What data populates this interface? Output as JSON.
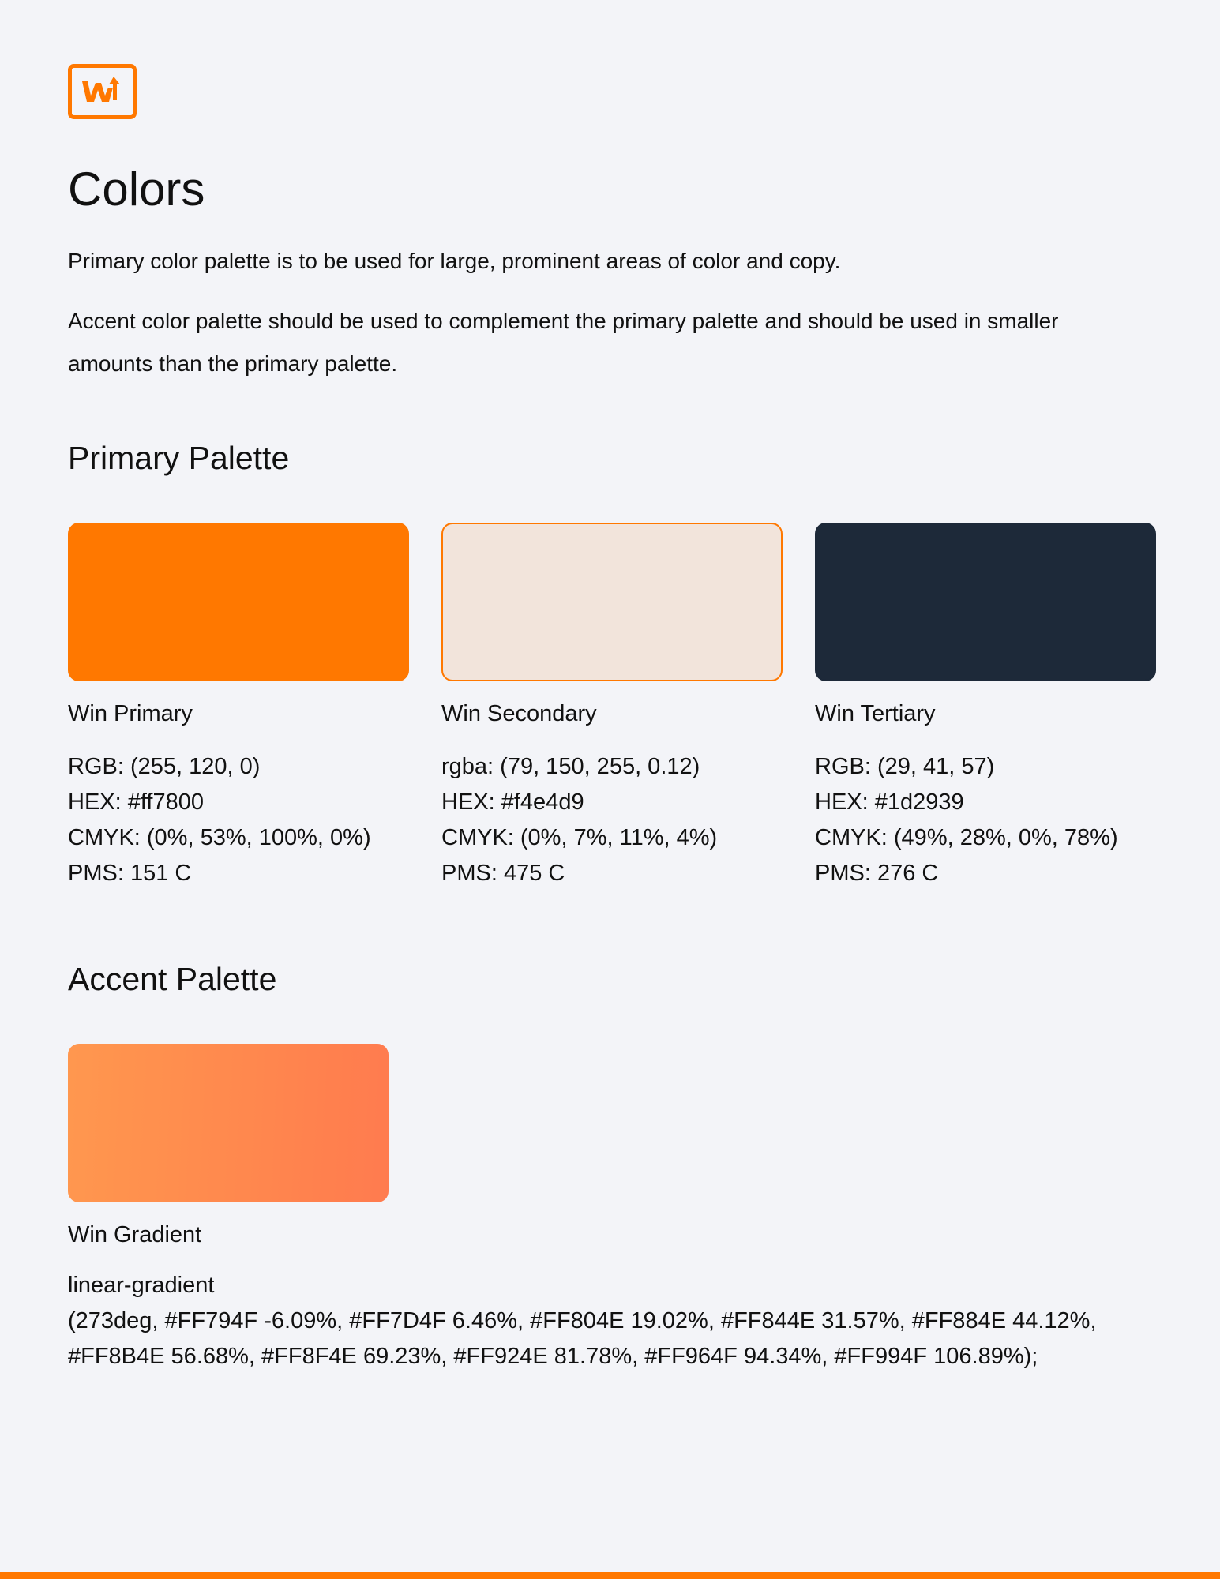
{
  "brand": {
    "logo_icon": "win-logo-icon",
    "accent_color": "#ff7800"
  },
  "page": {
    "title": "Colors",
    "background": "#f3f4f8",
    "intro": [
      "Primary color palette is to be used for large, prominent areas of color and copy.",
      "Accent color palette should be used to complement the primary palette and should be used in smaller amounts than the primary palette."
    ]
  },
  "primary_palette": {
    "heading": "Primary Palette",
    "swatches": [
      {
        "name": "Win Primary",
        "color": "#ff7800",
        "border": "#ff7800",
        "rgb": "RGB: (255, 120, 0)",
        "hex": "HEX: #ff7800",
        "cmyk": "CMYK: (0%, 53%, 100%, 0%)",
        "pms": "PMS: 151 C"
      },
      {
        "name": "Win Secondary",
        "color": "#f2e4db",
        "border": "#ff7800",
        "rgb": "rgba: (79, 150, 255, 0.12)",
        "hex": "HEX: #f4e4d9",
        "cmyk": "CMYK: (0%, 7%, 11%, 4%)",
        "pms": "PMS: 475 C"
      },
      {
        "name": "Win Tertiary",
        "color": "#1d2939",
        "border": "#1d2939",
        "rgb": "RGB: (29, 41, 57)",
        "hex": "HEX: #1d2939",
        "cmyk": "CMYK: (49%, 28%, 0%, 78%)",
        "pms": "PMS: 276 C"
      }
    ]
  },
  "accent_palette": {
    "heading": "Accent Palette",
    "swatches": [
      {
        "name": "Win Gradient",
        "value_line_1": "linear-gradient",
        "value_line_2": "(273deg, #FF794F -6.09%, #FF7D4F 6.46%, #FF804E 19.02%, #FF844E 31.57%, #FF884E 44.12%, #FF8B4E 56.68%, #FF8F4E 69.23%, #FF924E 81.78%, #FF964F 94.34%, #FF994F 106.89%);"
      }
    ]
  }
}
